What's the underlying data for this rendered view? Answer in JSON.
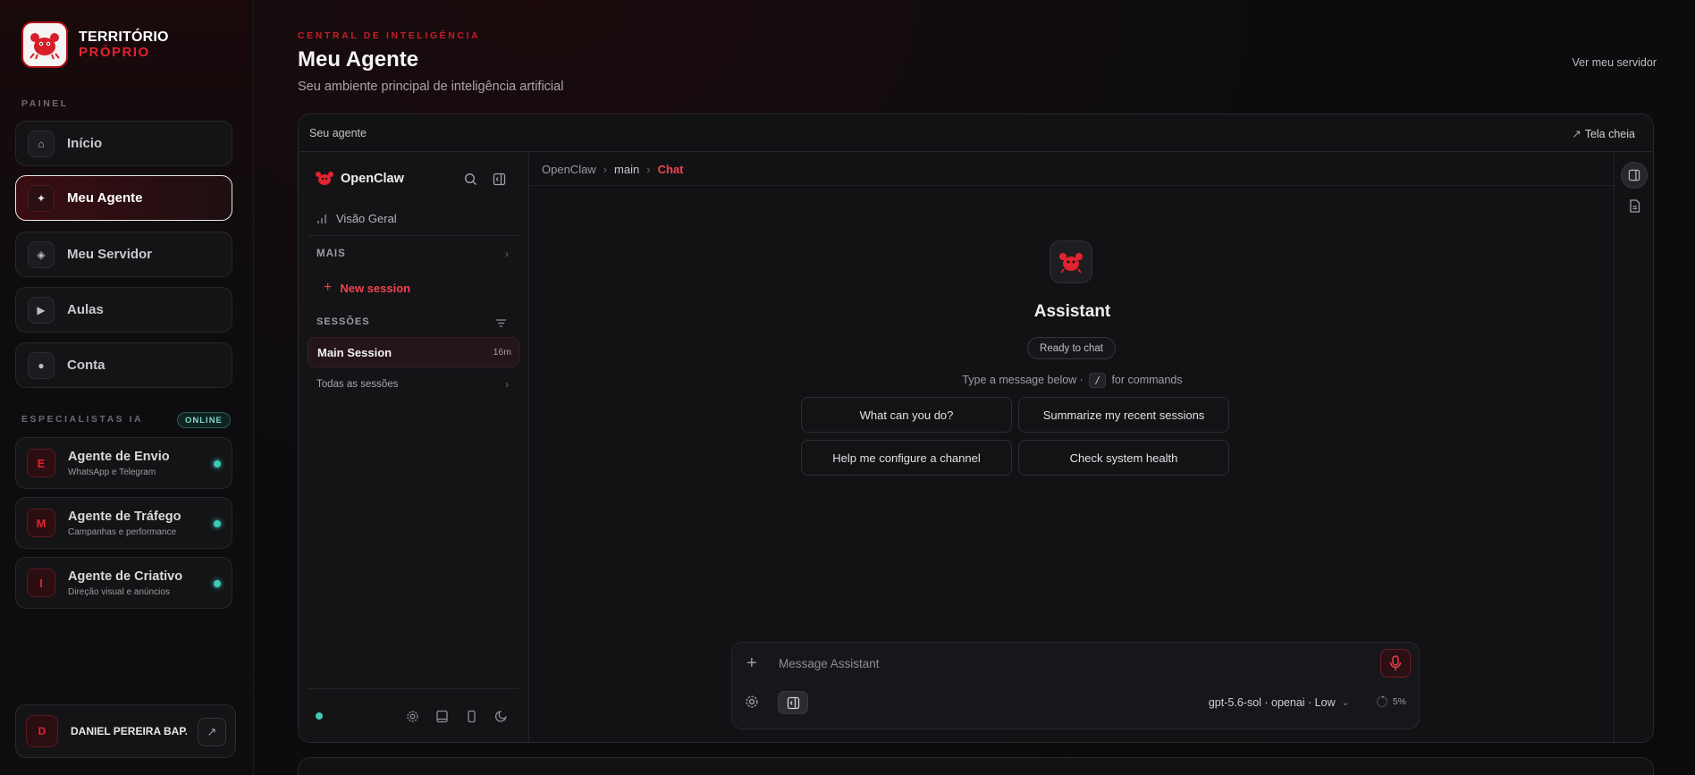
{
  "sidebar": {
    "brand": {
      "line1": "TERRITÓRIO",
      "line2": "PRÓPRIO"
    },
    "section_painel": "PAINEL",
    "nav": [
      {
        "label": "Início",
        "icon": "home-icon"
      },
      {
        "label": "Meu Agente",
        "icon": "sparkle-icon",
        "active": true
      },
      {
        "label": "Meu Servidor",
        "icon": "server-icon"
      },
      {
        "label": "Aulas",
        "icon": "play-icon"
      },
      {
        "label": "Conta",
        "icon": "account-icon"
      }
    ],
    "section_especialistas": "ESPECIALISTAS IA",
    "online_badge": "ONLINE",
    "agents": [
      {
        "letter": "E",
        "name": "Agente de Envio",
        "desc": "WhatsApp e Telegram"
      },
      {
        "letter": "M",
        "name": "Agente de Tráfego",
        "desc": "Campanhas e performance"
      },
      {
        "letter": "I",
        "name": "Agente de Criativo",
        "desc": "Direção visual e anúncios"
      }
    ],
    "user": {
      "initial": "D",
      "name": "DANIEL PEREIRA BAP..."
    }
  },
  "header": {
    "eyebrow": "CENTRAL DE INTELIGÊNCIA",
    "title": "Meu Agente",
    "subtitle": "Seu ambiente principal de inteligência artificial",
    "server_link": "Ver meu servidor"
  },
  "panel": {
    "title": "Seu agente",
    "fullscreen": "Tela cheia",
    "app": {
      "name": "OpenClaw",
      "overview": "Visão Geral",
      "mais": "MAIS",
      "new_session": "New session",
      "sessoes": "SESSÕES",
      "main_session": "Main Session",
      "main_session_time": "16m",
      "all_sessions": "Todas as sessões"
    },
    "breadcrumb": [
      "OpenClaw",
      "main",
      "Chat"
    ],
    "chat": {
      "assistant_name": "Assistant",
      "status": "Ready to chat",
      "hint_before": "Type a message below ·",
      "hint_key": "/",
      "hint_after": "for commands",
      "suggestions": [
        "What can you do?",
        "Summarize my recent sessions",
        "Help me configure a channel",
        "Check system health"
      ],
      "composer_placeholder": "Message Assistant",
      "model": "gpt-5.6-sol · openai · Low",
      "context_usage": "5%"
    }
  },
  "colors": {
    "accent_red": "#e3232e",
    "online_teal": "#3ec9b4",
    "background": "#0b0b0d"
  }
}
